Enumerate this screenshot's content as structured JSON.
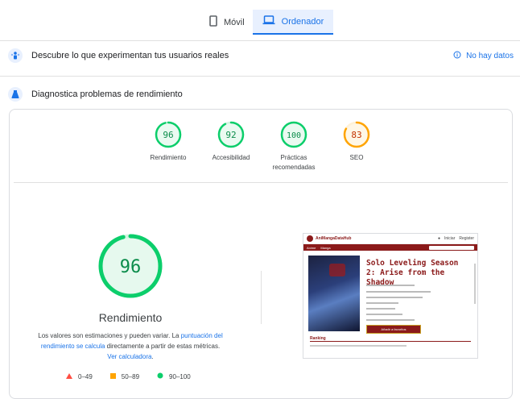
{
  "tabs": [
    {
      "label": "Móvil",
      "icon": "phone-icon",
      "active": false
    },
    {
      "label": "Ordenador",
      "icon": "laptop-icon",
      "active": true
    }
  ],
  "field_data": {
    "title": "Descubre lo que experimentan tus usuarios reales",
    "status": "No hay datos"
  },
  "diagnostics": {
    "title": "Diagnostica problemas de rendimiento"
  },
  "scores": [
    {
      "value": "96",
      "label": "Rendimiento",
      "score": 0.96,
      "color": "#0cce6b"
    },
    {
      "value": "92",
      "label": "Accesibilidad",
      "score": 0.92,
      "color": "#0cce6b"
    },
    {
      "value": "100",
      "label": "Prácticas recomendadas",
      "score": 1.0,
      "color": "#0cce6b"
    },
    {
      "value": "83",
      "label": "SEO",
      "score": 0.83,
      "color": "#ffa400"
    }
  ],
  "performance": {
    "score": "96",
    "score_fraction": 0.96,
    "title": "Rendimiento",
    "disclaimer_pre": "Los valores son estimaciones y pueden variar. La ",
    "disclaimer_link1": "puntuación del rendimiento se calcula",
    "disclaimer_mid": " directamente a partir de estas métricas. ",
    "disclaimer_link2": "Ver calculadora",
    "disclaimer_end": "."
  },
  "legend": [
    {
      "range": "0–49",
      "color": "#ff4e42"
    },
    {
      "range": "50–89",
      "color": "#ffa400"
    },
    {
      "range": "90–100",
      "color": "#0cce6b"
    }
  ],
  "screenshot": {
    "brand": "AniMangaDataHub",
    "login": "Iniciar",
    "register": "Register",
    "nav_anime": "Anime",
    "nav_manga": "Manga",
    "title": "Solo Leveling Season 2: Arise from the Shadow",
    "button": "Añadir a favoritos",
    "section": "Ranking"
  },
  "colors": {
    "accent": "#1a73e8",
    "pass": "#0cce6b",
    "average": "#ffa400",
    "fail": "#ff4e42"
  }
}
